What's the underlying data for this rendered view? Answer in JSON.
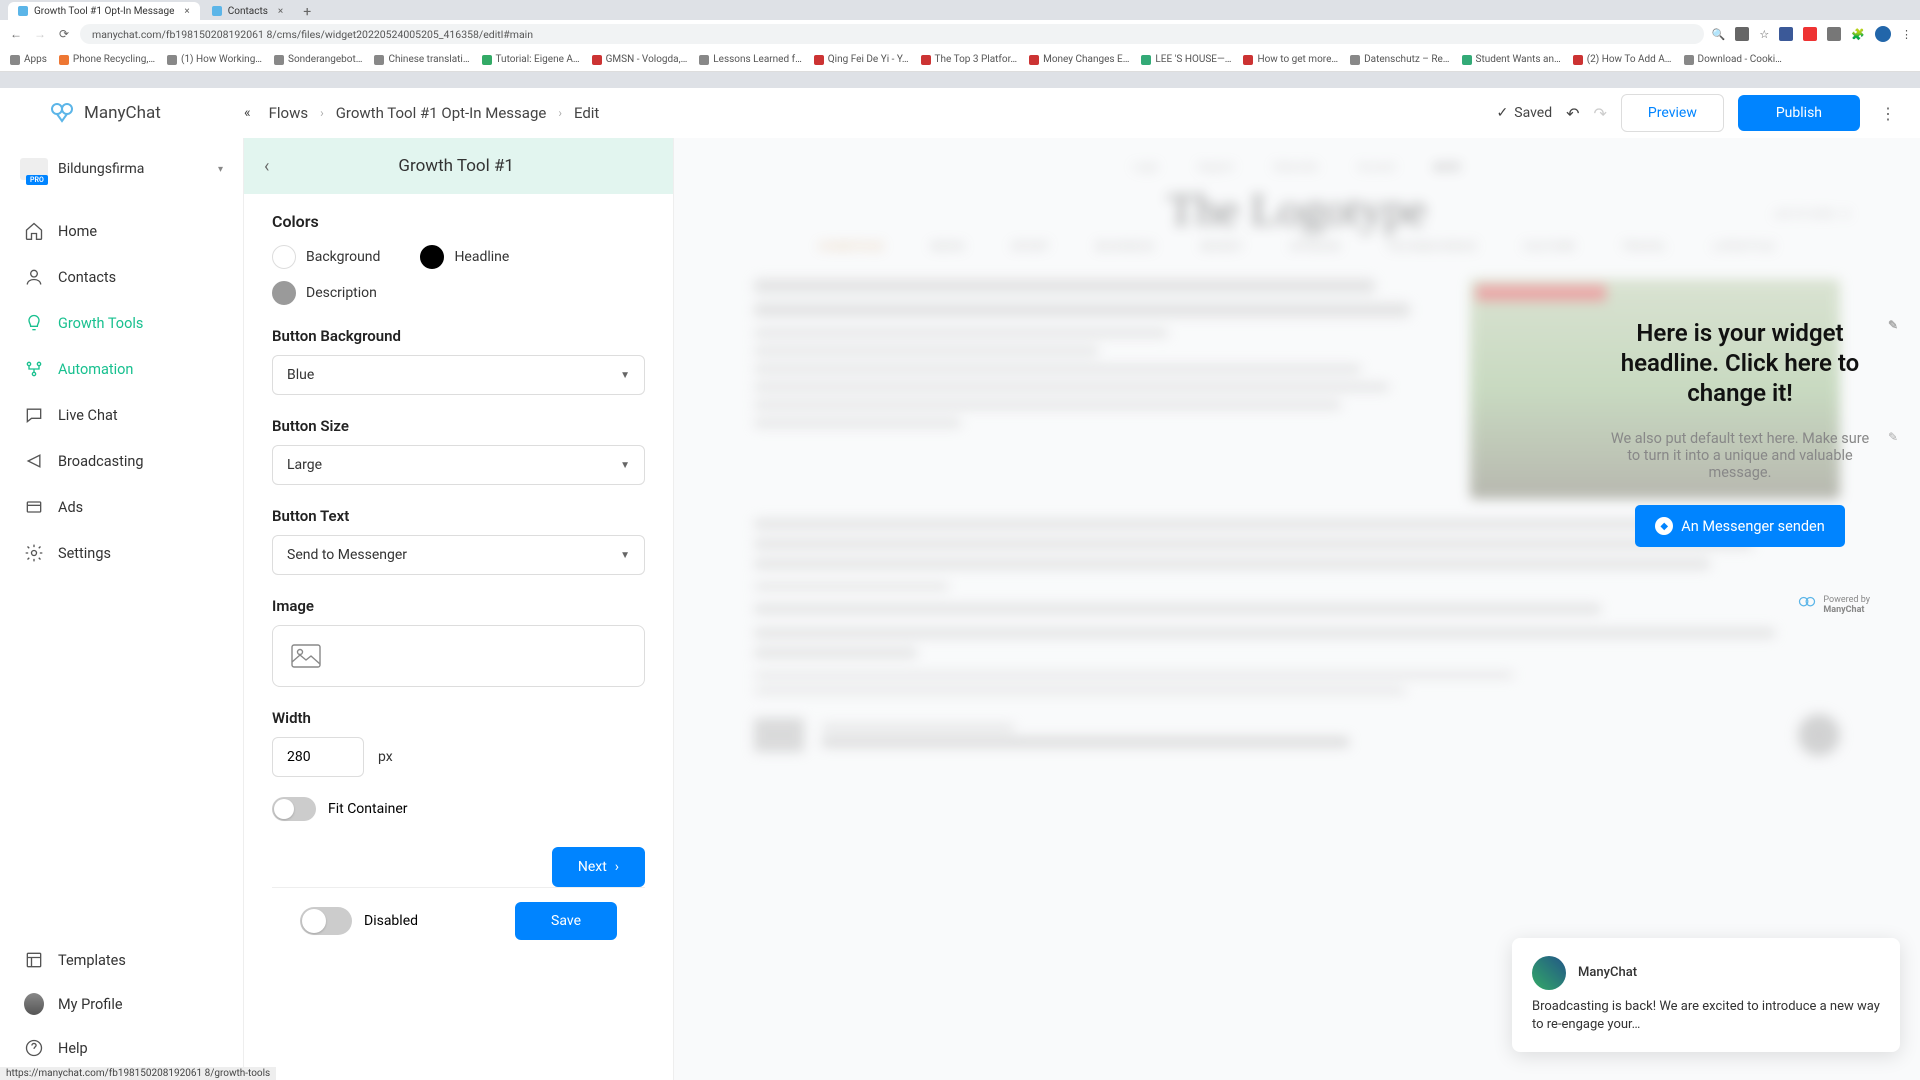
{
  "browser": {
    "tabs": [
      {
        "title": "Growth Tool #1 Opt-In Message"
      },
      {
        "title": "Contacts"
      }
    ],
    "url": "manychat.com/fb198150208192061 8/cms/files/widget20220524005205_416358/editl#main",
    "bookmarks": [
      "Apps",
      "Phone Recycling,…",
      "(1) How Working…",
      "Sonderangebot…",
      "Chinese translati…",
      "Tutorial: Eigene A…",
      "GMSN - Vologda,…",
      "Lessons Learned f…",
      "Qing Fei De Yi - Y…",
      "The Top 3 Platfor…",
      "Money Changes E…",
      "LEE 'S HOUSE—…",
      "How to get more…",
      "Datenschutz – Re…",
      "Student Wants an…",
      "(2) How To Add A…",
      "Download - Cooki…"
    ]
  },
  "logo": "ManyChat",
  "org": {
    "name": "Bildungsfirma",
    "badge": "PRO"
  },
  "breadcrumb": {
    "flows": "Flows",
    "tool": "Growth Tool #1 Opt-In Message",
    "edit": "Edit"
  },
  "header": {
    "saved": "Saved",
    "preview": "Preview",
    "publish": "Publish"
  },
  "sidebar": {
    "items": [
      {
        "label": "Home"
      },
      {
        "label": "Contacts"
      },
      {
        "label": "Growth Tools"
      },
      {
        "label": "Automation"
      },
      {
        "label": "Live Chat"
      },
      {
        "label": "Broadcasting"
      },
      {
        "label": "Ads"
      },
      {
        "label": "Settings"
      }
    ],
    "bottom": [
      {
        "label": "Templates"
      },
      {
        "label": "My Profile"
      },
      {
        "label": "Help"
      }
    ]
  },
  "panel": {
    "title": "Growth Tool #1",
    "colors_label": "Colors",
    "color_background": "Background",
    "color_headline": "Headline",
    "color_description": "Description",
    "btn_bg_label": "Button Background",
    "btn_bg_value": "Blue",
    "btn_size_label": "Button Size",
    "btn_size_value": "Large",
    "btn_text_label": "Button Text",
    "btn_text_value": "Send to Messenger",
    "image_label": "Image",
    "width_label": "Width",
    "width_value": "280",
    "width_unit": "px",
    "fit_label": "Fit Container",
    "next": "Next",
    "disabled": "Disabled",
    "save": "Save"
  },
  "widget": {
    "headline": "Here is your widget headline. Click here to change it!",
    "description": "We also put default text here. Make sure to turn it into a unique and valuable message.",
    "button": "An Messenger senden",
    "powered_prefix": "Powered by",
    "powered_name": "ManyChat"
  },
  "notif": {
    "title": "ManyChat",
    "body": "Broadcasting is back! We are excited to introduce a new way to re-engage your…"
  },
  "status_url": "https://manychat.com/fb198150208192061 8/growth-tools",
  "colors": {
    "swatch_bg": "#ffffff",
    "swatch_headline": "#000000",
    "swatch_desc": "#9a9a9a"
  }
}
